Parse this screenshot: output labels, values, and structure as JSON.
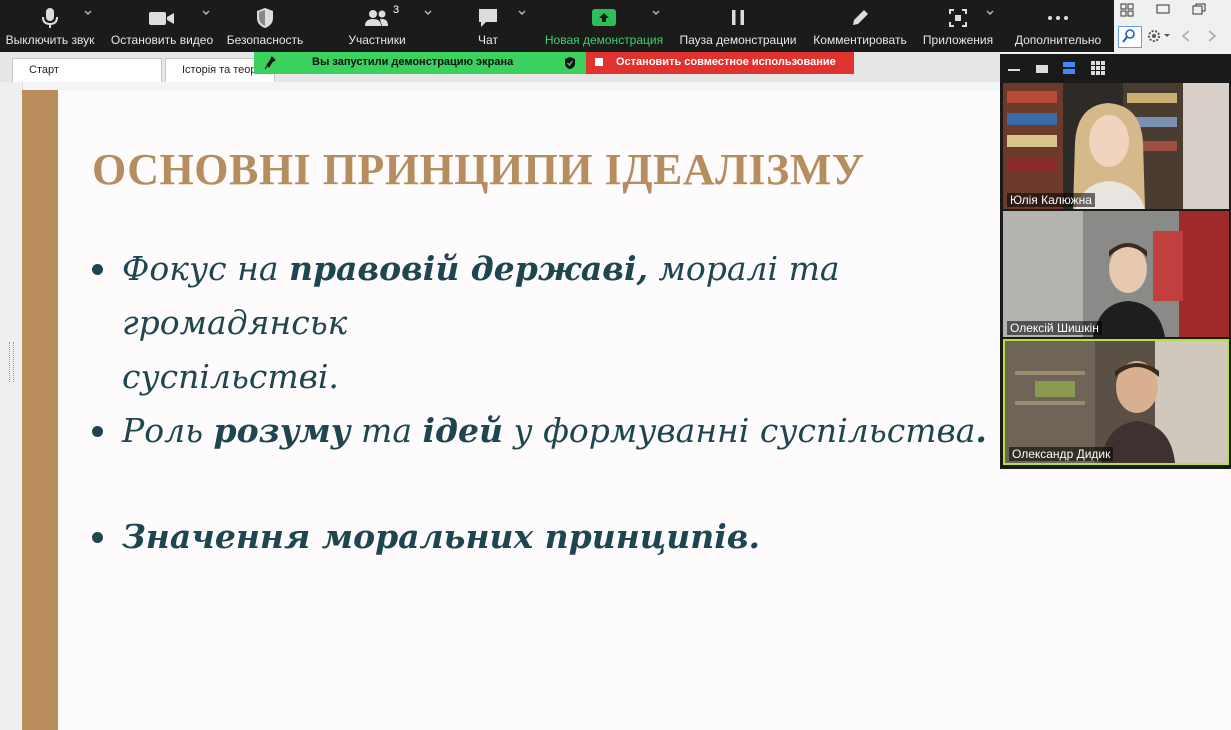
{
  "toolbar": {
    "mute_label": "Выключить звук",
    "video_label": "Остановить видео",
    "security_label": "Безопасность",
    "participants_label": "Участники",
    "participants_count": "3",
    "chat_label": "Чат",
    "new_share_label": "Новая демонстрация",
    "pause_share_label": "Пауза демонстрации",
    "annotate_label": "Комментировать",
    "apps_label": "Приложения",
    "more_label": "Дополнительно"
  },
  "tabs": [
    {
      "label": "Старт"
    },
    {
      "label": "Історія та теор"
    }
  ],
  "share_bar": {
    "status": "Вы запустили демонстрацию экрана",
    "stop": "Остановить совместное использование"
  },
  "slide": {
    "title": "ОСНОВНІ ПРИНЦИПИ ІДЕАЛІЗМУ",
    "bullets": [
      {
        "p1": "Фокус на ",
        "b1": "правовій державі,",
        "p2": " моралі та громадянськ",
        "p3": "суспільстві."
      },
      {
        "p1": "Роль ",
        "b1": "розуму",
        "p2": " та ",
        "b2": "ідей",
        "p3": " у формуванні суспільства",
        "b3": "."
      },
      {
        "b1": "Значення моральних принципів."
      }
    ]
  },
  "gallery": {
    "participants": [
      {
        "name": "Юлія Калюжна"
      },
      {
        "name": "Олексій Шишкін"
      },
      {
        "name": "Олександр Дидик"
      }
    ]
  },
  "colors": {
    "toolbar_bg": "#1b1b1b",
    "accent_green": "#3fd06b",
    "stop_red": "#e0322e",
    "slide_title": "#b58d5f",
    "slide_text": "#1f4650",
    "slide_bar": "#b98e5c"
  }
}
